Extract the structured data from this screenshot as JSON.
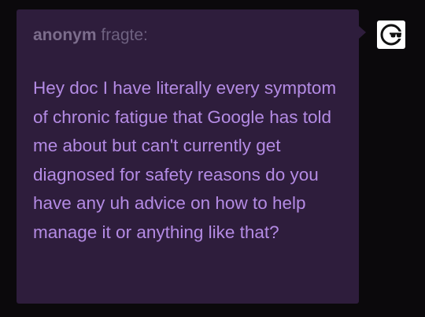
{
  "ask": {
    "asker_name": "anonym",
    "asker_verb": "fragte:",
    "question_text": "Hey doc I have literally every symptom of chronic fatigue that Google has told me about but can't currently get diagnosed for safety reasons do you have any uh advice on how to help manage it or anything like that?"
  },
  "avatar": {
    "icon": "anonymous-sunglasses-icon",
    "background": "#ffffff"
  },
  "colors": {
    "page_background": "#0b090c",
    "bubble_background": "#2e1d3c",
    "question_text": "#b48be4",
    "asker_text": "#7c6d8c"
  }
}
